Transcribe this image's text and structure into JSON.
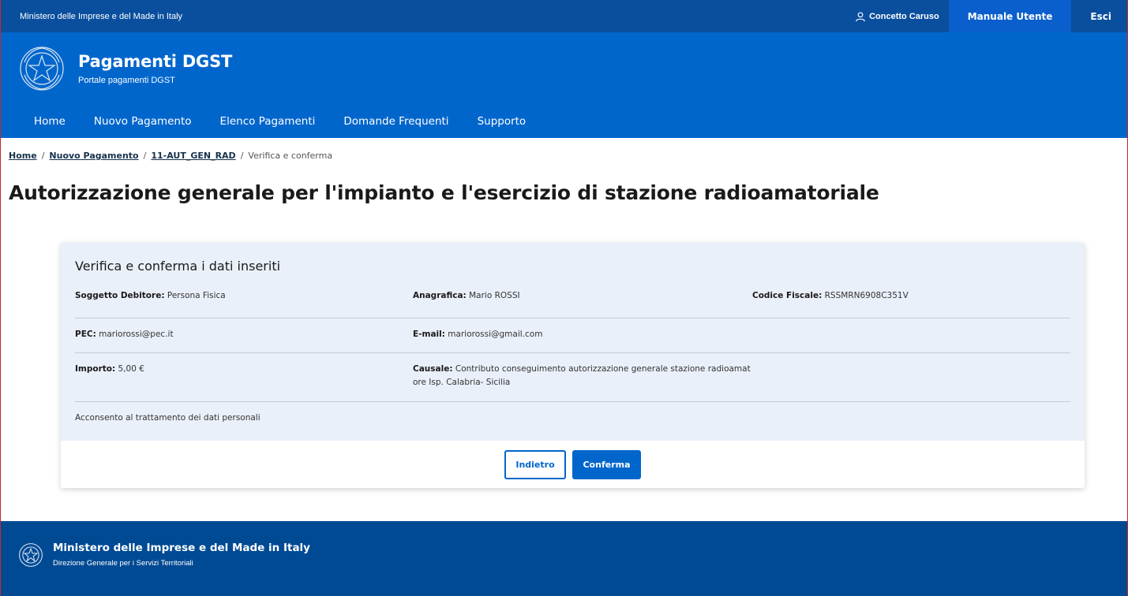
{
  "slim_header": {
    "ministry": "Ministero delle Imprese e del Made in Italy",
    "user_name": "Concetto Caruso",
    "manual_label": "Manuale Utente",
    "exit_label": "Esci"
  },
  "header": {
    "title": "Pagamenti DGST",
    "subtitle": "Portale pagamenti DGST",
    "nav": [
      {
        "label": "Home"
      },
      {
        "label": "Nuovo Pagamento"
      },
      {
        "label": "Elenco Pagamenti"
      },
      {
        "label": "Domande Frequenti"
      },
      {
        "label": "Supporto"
      }
    ]
  },
  "breadcrumb": {
    "items": [
      "Home",
      "Nuovo Pagamento",
      "11-AUT_GEN_RAD"
    ],
    "separator": "/",
    "current": "Verifica e conferma"
  },
  "page_title": "Autorizzazione generale per l'impianto e l'esercizio di stazione radioamatoriale",
  "card": {
    "title": "Verifica e conferma i dati inseriti",
    "fields": {
      "soggetto_label": "Soggetto Debitore:",
      "soggetto_value": " Persona Fisica",
      "anagrafica_label": "Anagrafica:",
      "anagrafica_value": " Mario ROSSI",
      "cf_label": "Codice Fiscale:",
      "cf_value": " RSSMRN6908C351V",
      "pec_label": "PEC:",
      "pec_value": " mariorossi@pec.it",
      "email_label": "E-mail:",
      "email_value": " mariorossi@gmail.com",
      "importo_label": "Importo:",
      "importo_value": " 5,00 €",
      "causale_label": "Causale:",
      "causale_value_line1": " Contributo conseguimento autorizzazione generale stazione radioamat",
      "causale_value_line2": "ore Isp. Calabria- Sicilia"
    },
    "consent": "Acconsento al trattamento dei dati personali",
    "back_label": "Indietro",
    "confirm_label": "Conferma"
  },
  "footer": {
    "title": "Ministero delle Imprese e del Made in Italy",
    "subtitle": "Direzione Generale per i Servizi Territoriali"
  },
  "colors": {
    "slim_bar": "#0a4f9e",
    "header": "#0066cc",
    "card_body": "#eaf0f9",
    "footer": "#004a94",
    "accent": "#0066cc"
  },
  "icons": [
    "user-icon",
    "emblem-icon"
  ]
}
